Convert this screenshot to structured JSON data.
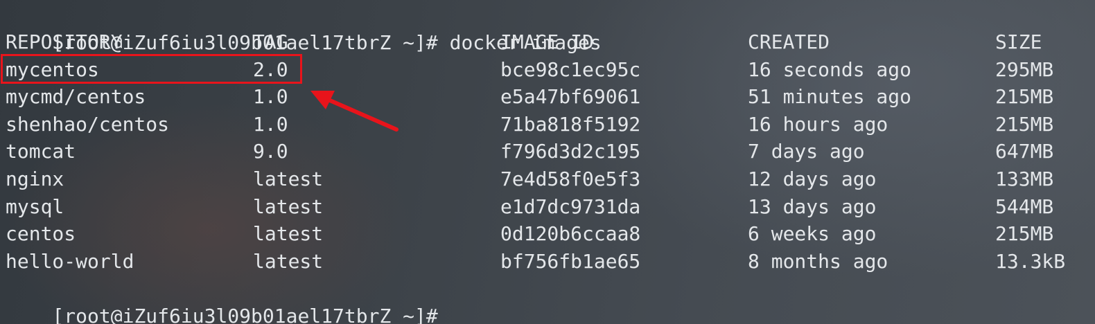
{
  "terminal": {
    "prompt": "[root@iZuf6iu3l09b01ael17tbrZ ~]#",
    "command": "docker images",
    "final_prompt": "[root@iZuf6iu3l09b01ael17tbrZ ~]#"
  },
  "table": {
    "headers": {
      "repository": "REPOSITORY",
      "tag": "TAG",
      "image_id": "IMAGE ID",
      "created": "CREATED",
      "size": "SIZE"
    },
    "rows": [
      {
        "repository": "mycentos",
        "tag": "2.0",
        "image_id": "bce98c1ec95c",
        "created": "16 seconds ago",
        "size": "295MB"
      },
      {
        "repository": "mycmd/centos",
        "tag": "1.0",
        "image_id": "e5a47bf69061",
        "created": "51 minutes ago",
        "size": "215MB"
      },
      {
        "repository": "shenhao/centos",
        "tag": "1.0",
        "image_id": "71ba818f5192",
        "created": "16 hours ago",
        "size": "215MB"
      },
      {
        "repository": "tomcat",
        "tag": "9.0",
        "image_id": "f796d3d2c195",
        "created": "7 days ago",
        "size": "647MB"
      },
      {
        "repository": "nginx",
        "tag": "latest",
        "image_id": "7e4d58f0e5f3",
        "created": "12 days ago",
        "size": "133MB"
      },
      {
        "repository": "mysql",
        "tag": "latest",
        "image_id": "e1d7dc9731da",
        "created": "13 days ago",
        "size": "544MB"
      },
      {
        "repository": "centos",
        "tag": "latest",
        "image_id": "0d120b6ccaa8",
        "created": "6 weeks ago",
        "size": "215MB"
      },
      {
        "repository": "hello-world",
        "tag": "latest",
        "image_id": "bf756fb1ae65",
        "created": "8 months ago",
        "size": "13.3kB"
      }
    ]
  },
  "annotation": {
    "color": "#e8141b",
    "highlighted_row": "mycentos"
  },
  "colors": {
    "text": "#e4e7ea",
    "background": "#41474d"
  }
}
